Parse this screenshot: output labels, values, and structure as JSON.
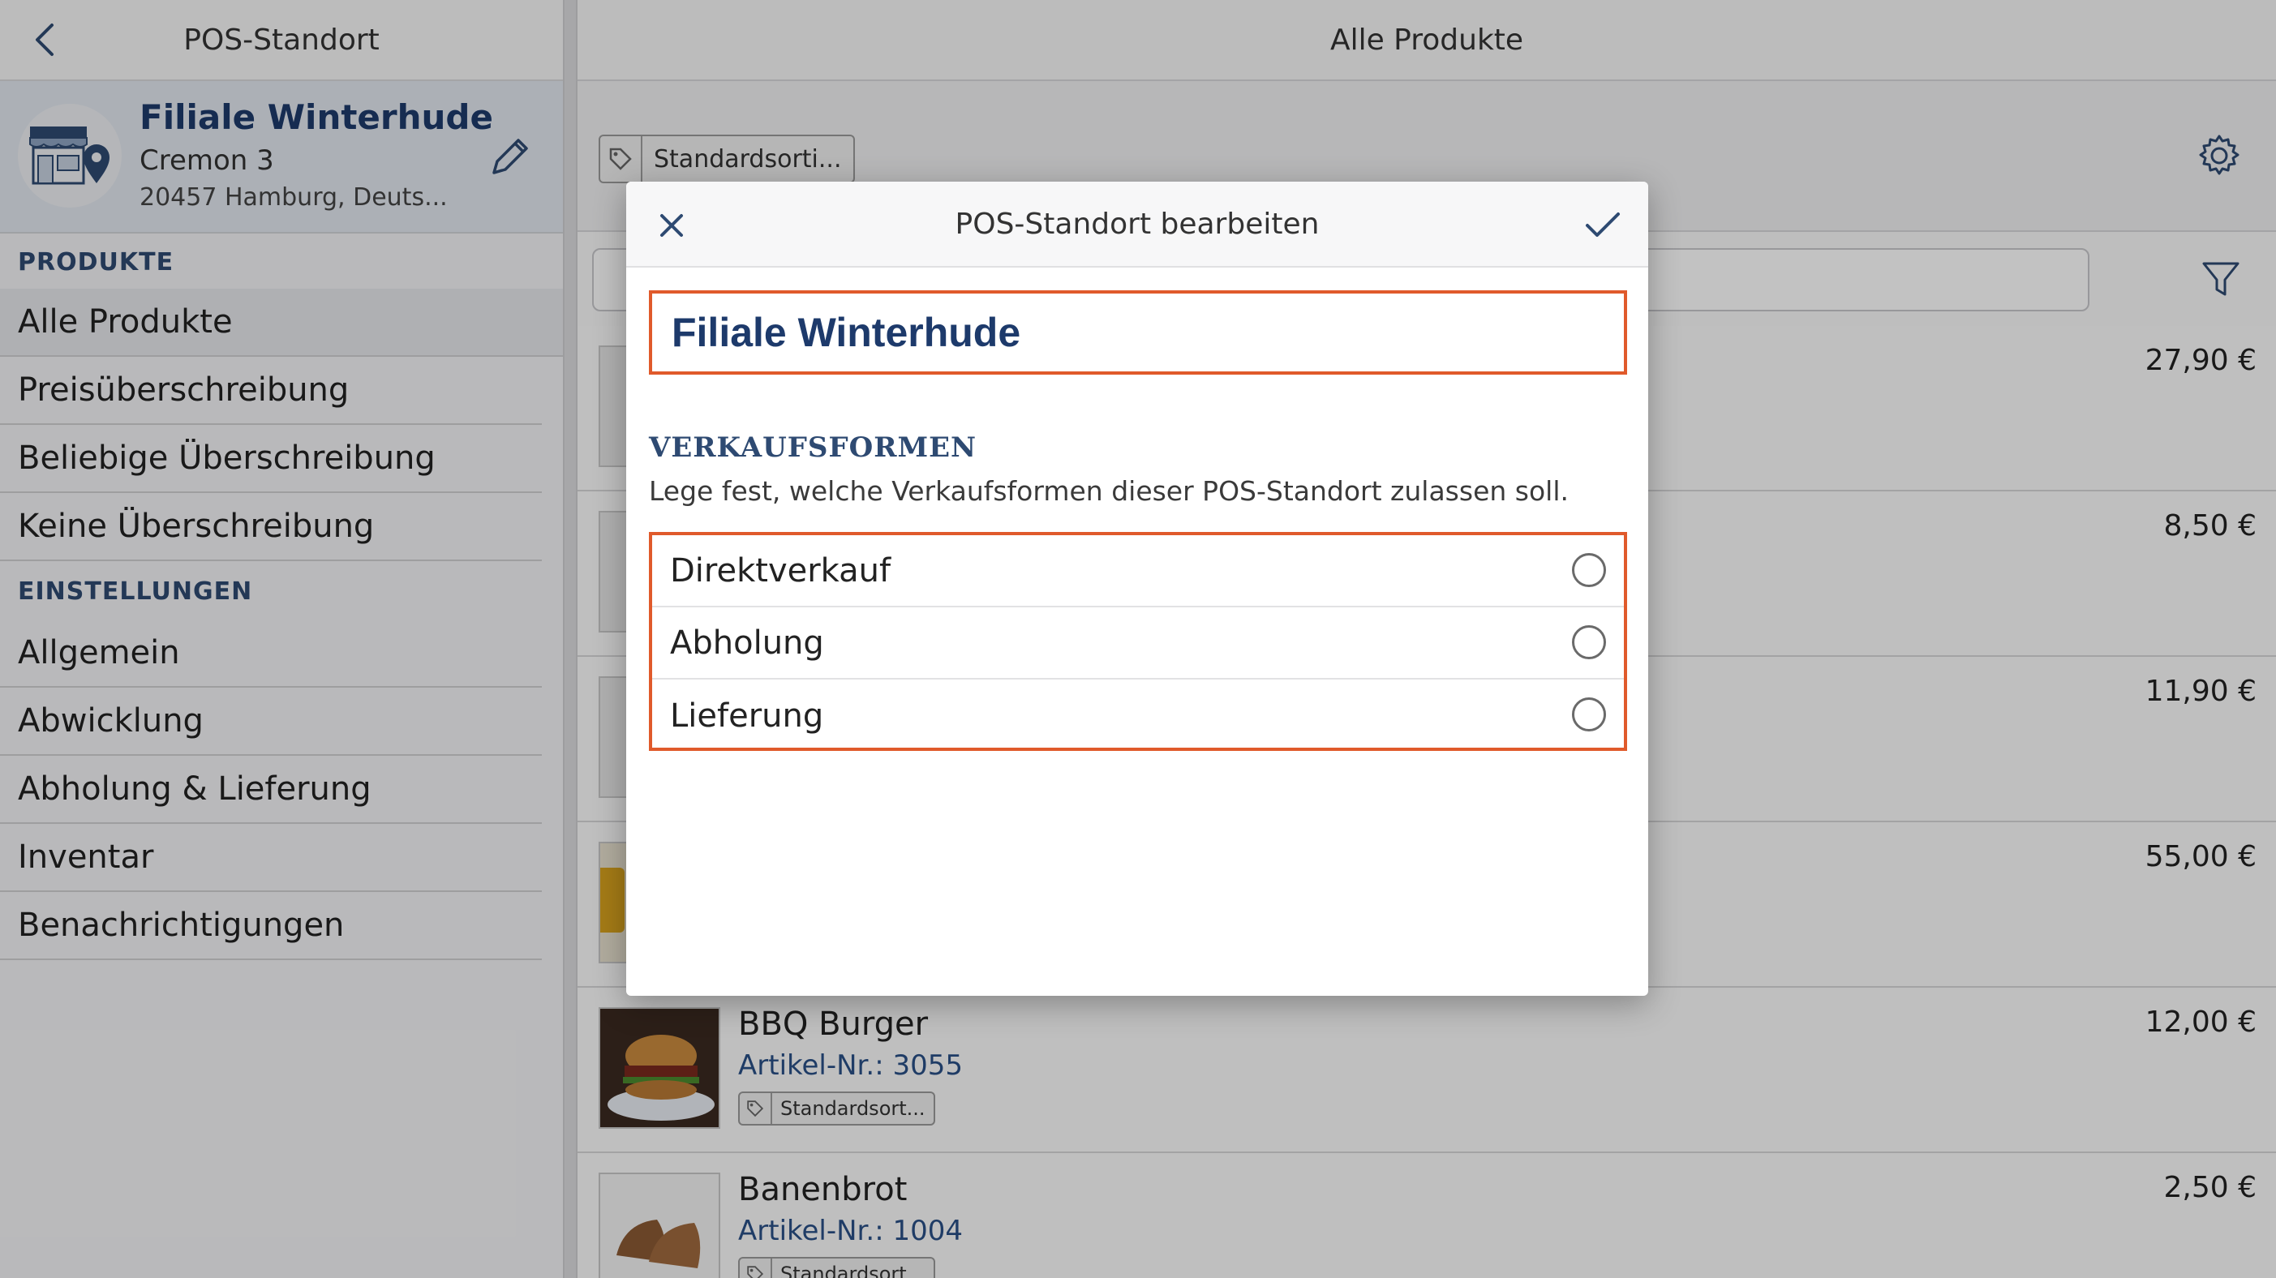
{
  "sidebar": {
    "header_title": "POS-Standort",
    "store": {
      "name": "Filiale Winterhude",
      "street": "Cremon 3",
      "city": "20457 Hamburg, Deuts..."
    },
    "sections": [
      {
        "title": "PRODUKTE",
        "items": [
          "Alle Produkte",
          "Preisüberschreibung",
          "Beliebige Überschreibung",
          "Keine Überschreibung"
        ]
      },
      {
        "title": "EINSTELLUNGEN",
        "items": [
          "Allgemein",
          "Abwicklung",
          "Abholung & Lieferung",
          "Inventar",
          "Benachrichtigungen"
        ]
      }
    ]
  },
  "main": {
    "header_title": "Alle Produkte",
    "tag_filter": "Standardsorti...",
    "products": [
      {
        "price": "27,90 €"
      },
      {
        "price": "8,50 €"
      },
      {
        "price": "11,90 €"
      },
      {
        "price": "55,00 €"
      },
      {
        "name": "BBQ Burger",
        "number": "Artikel-Nr.: 3055",
        "tag": "Standardsort...",
        "price": "12,00 €"
      },
      {
        "name": "Banenbrot",
        "number": "Artikel-Nr.: 1004",
        "tag": "Standardsort...",
        "price": "2,50 €"
      }
    ]
  },
  "modal": {
    "title": "POS-Standort bearbeiten",
    "name_value": "Filiale Winterhude",
    "section_title": "VERKAUFSFORMEN",
    "section_desc": "Lege fest, welche Verkaufsformen dieser POS-Standort zulassen soll.",
    "options": [
      "Direktverkauf",
      "Abholung",
      "Lieferung"
    ]
  },
  "colors": {
    "accent_navy": "#1d3a6b",
    "highlight_border": "#e05a2b"
  },
  "icons": {
    "back": "chevron-left-icon",
    "store": "store-location-icon",
    "edit": "pencil-icon",
    "settings": "gear-icon",
    "filter": "filter-icon",
    "tag": "tag-icon",
    "close": "close-icon",
    "confirm": "checkmark-icon"
  }
}
